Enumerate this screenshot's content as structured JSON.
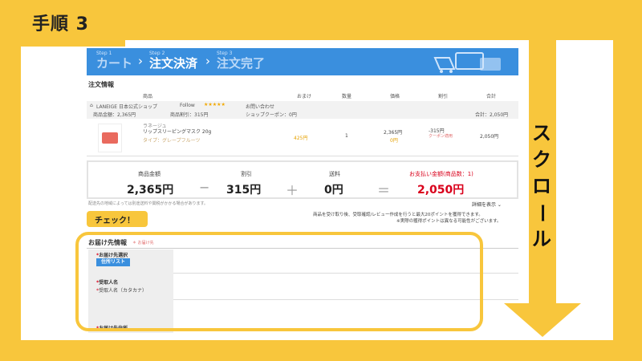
{
  "step_label": "手順 3",
  "breadcrumb": {
    "step1_small": "Step 1",
    "step1": "カート",
    "step2_small": "Step 2",
    "step2": "注文決済",
    "step3_small": "Step 3",
    "step3": "注文完了",
    "sep": "›"
  },
  "order": {
    "title": "注文情報",
    "headers": [
      "商品",
      "おまけ",
      "数量",
      "価格",
      "割引",
      "合計"
    ],
    "shop": {
      "name": "LANEIGE 日本公式ショップ",
      "rating_label": "Follow",
      "stars": "★★★★★",
      "inquiry": "お問い合わせ",
      "subtotal": "商品金額：2,365円",
      "discount": "商品割引：315円",
      "coupon": "ショップクーポン：0円",
      "total": "合計：2,050円"
    },
    "product": {
      "tag": "ラネージュ",
      "name": "リップスリーピングマスク 20g",
      "type": "タイプ：グレープフルーツ",
      "points": "425円",
      "qty": "1",
      "price": "2,365円",
      "price_sub": "0円",
      "discount": "-315円",
      "discount_link": "クーポン適用",
      "total": "2,050円"
    }
  },
  "summary": {
    "label_subtotal": "商品金額",
    "subtotal": "2,365円",
    "op_minus": "−",
    "label_discount": "割引",
    "discount": "315円",
    "op_plus": "＋",
    "label_shipping": "送料",
    "shipping": "0円",
    "op_equals": "＝",
    "label_pay": "お支払い金額(商品数：1)",
    "pay": "2,050円"
  },
  "note": "配送先の地域によっては別途送料や関税がかかる場合があります。",
  "detail_button": "詳細を表示 ⌄",
  "points_note1": "商品を受け取り後、受取確認/レビュー作成を行うと最大20ポイントを獲得できます。",
  "points_note2": "※実際の獲得ポイントは異なる可能性がございます。",
  "check_badge": "チェック！",
  "delivery": {
    "title": "お届け先情報",
    "note": "＊ お届け先",
    "field1_label": "お届け先選択",
    "field1_button": "住所リスト",
    "field2_label": "受取人名",
    "field2_sub": "受取人名（カタカナ）",
    "field3_label": "お届け先住所"
  },
  "scroll_text": "スクロール",
  "colors": {
    "accent": "#f8c63c",
    "brand": "#3a8fde",
    "price_red": "#d9001b"
  }
}
